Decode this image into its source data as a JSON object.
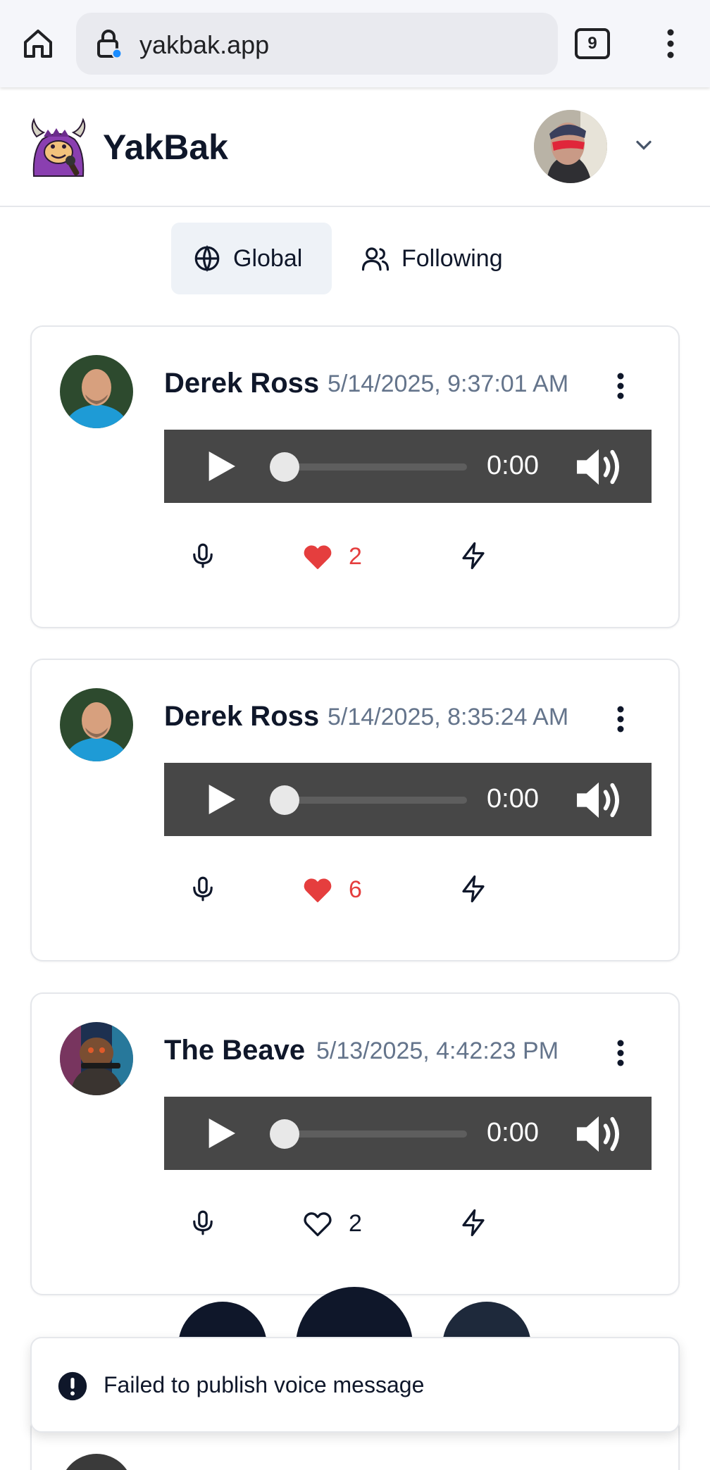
{
  "browser": {
    "url": "yakbak.app",
    "tab_count": "9"
  },
  "app": {
    "brand": "YakBak"
  },
  "tabs": [
    {
      "label": "Global",
      "active": true
    },
    {
      "label": "Following",
      "active": false
    }
  ],
  "posts": [
    {
      "author": "Derek Ross",
      "timestamp": "5/14/2025, 9:37:01 AM",
      "time": "0:00",
      "likes": "2",
      "liked": true
    },
    {
      "author": "Derek Ross",
      "timestamp": "5/14/2025, 8:35:24 AM",
      "time": "0:00",
      "likes": "6",
      "liked": true
    },
    {
      "author": "The Beave",
      "timestamp": "5/13/2025, 4:42:23 PM",
      "time": "0:00",
      "likes": "2",
      "liked": false
    }
  ],
  "toast": {
    "message": "Failed to publish voice message"
  },
  "colors": {
    "accent_like": "#e53e3e",
    "player_bg": "#474747",
    "text_primary": "#0f172a",
    "text_muted": "#64748b"
  },
  "icons": [
    "home-icon",
    "lock-icon",
    "tabs-icon",
    "more-vert-icon",
    "chevron-down-icon",
    "globe-icon",
    "users-icon",
    "play-icon",
    "volume-icon",
    "mic-icon",
    "heart-icon",
    "zap-icon",
    "alert-icon"
  ]
}
